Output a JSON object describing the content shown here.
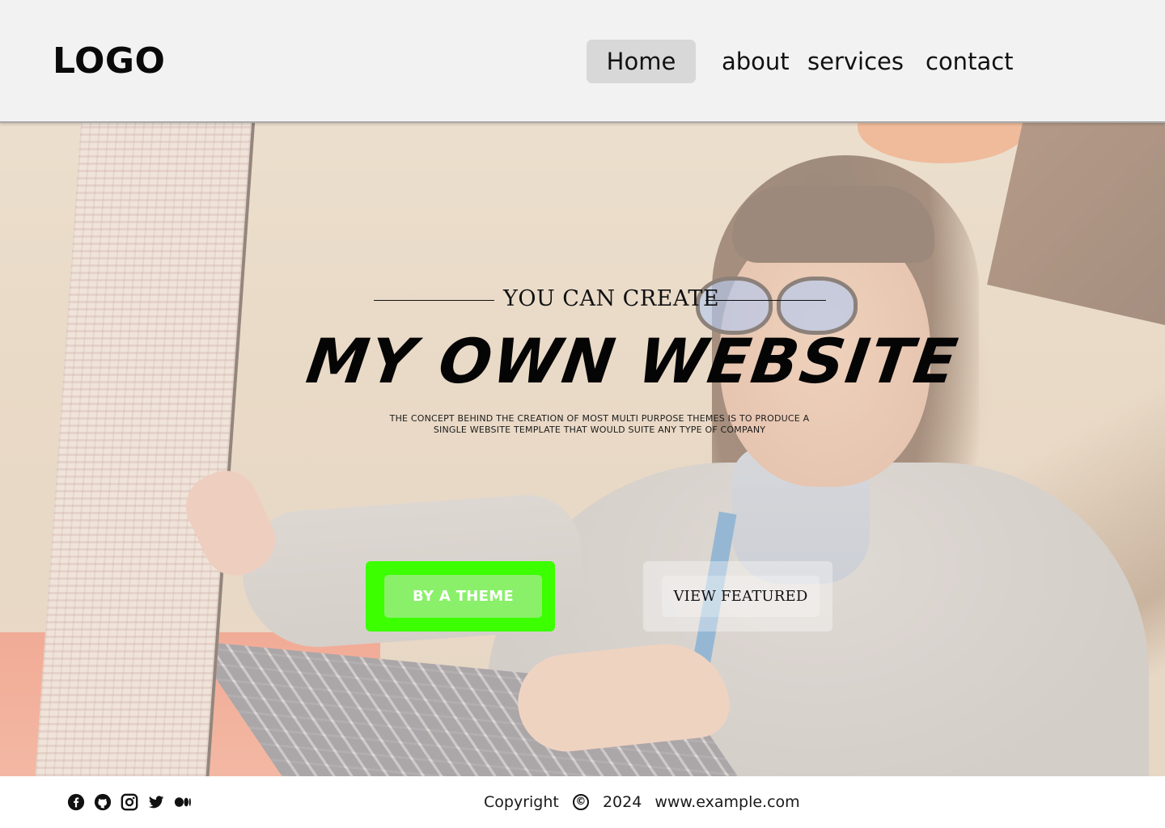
{
  "header": {
    "logo": "LOGO",
    "nav": [
      {
        "label": "Home",
        "active": true
      },
      {
        "label": "about",
        "active": false
      },
      {
        "label": "services",
        "active": false
      },
      {
        "label": "contact",
        "active": false
      }
    ]
  },
  "hero": {
    "eyebrow": "YOU CAN CREATE",
    "headline": "MY OWN WEBSITE",
    "subtext_line1": "THE  CONCEPT BEHIND THE CREATION OF MOST  MULTI PURPOSE THEMES IS TO PRODUCE A",
    "subtext_line2": "SINGLE WEBSITE TEMPLATE THAT WOULD SUITE ANY  TYPE OF COMPANY",
    "primary_button": "BY A THEME",
    "secondary_button": "VIEW FEATURED",
    "background_image": "woman-at-laptop-photo"
  },
  "footer": {
    "social_icons": [
      "facebook-icon",
      "github-icon",
      "instagram-icon",
      "twitter-icon",
      "medium-icon"
    ],
    "copyright_label": "Copyright",
    "copyright_symbol": "©",
    "year": "2024",
    "site": "www.example.com"
  },
  "colors": {
    "header_bg": "#f2f2f2",
    "nav_active_bg": "#d8d8d8",
    "primary_button_outer": "#3cff00",
    "primary_button_inner": "#8af06a"
  }
}
